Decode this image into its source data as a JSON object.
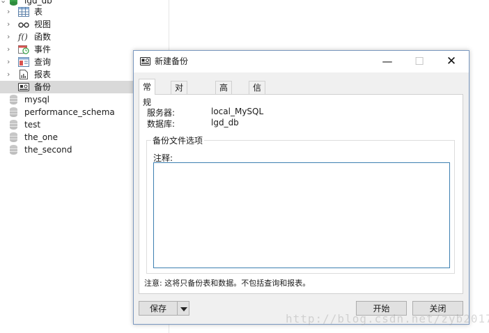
{
  "tree": {
    "parent_db": "lgd_db",
    "children": [
      {
        "label": "表",
        "icon": "table-icon"
      },
      {
        "label": "视图",
        "icon": "view-icon"
      },
      {
        "label": "函数",
        "icon": "function-icon"
      },
      {
        "label": "事件",
        "icon": "event-icon"
      },
      {
        "label": "查询",
        "icon": "query-icon"
      },
      {
        "label": "报表",
        "icon": "report-icon"
      },
      {
        "label": "备份",
        "icon": "backup-icon"
      }
    ],
    "databases": [
      "mysql",
      "performance_schema",
      "test",
      "the_one",
      "the_second"
    ]
  },
  "dialog": {
    "title": "新建备份",
    "tabs": [
      "常规",
      "对象选择",
      "高级",
      "信息日志"
    ],
    "server_label": "服务器:",
    "server_value": "local_MySQL",
    "database_label": "数据库:",
    "database_value": "lgd_db",
    "group_title": "备份文件选项",
    "comment_label": "注释:",
    "comment_value": "",
    "note": "注意: 这将只备份表和数据。不包括查询和报表。",
    "save_button": "保存",
    "start_button": "开始",
    "close_button": "关闭"
  },
  "watermark": "http://blog.csdn.net/zyb2017",
  "colors": {
    "selected_row": "#d9d9d9",
    "dialog_bg": "#f0f0f0",
    "focus_border": "#3c7fb1",
    "db_icon_green": "#3aa34b"
  }
}
